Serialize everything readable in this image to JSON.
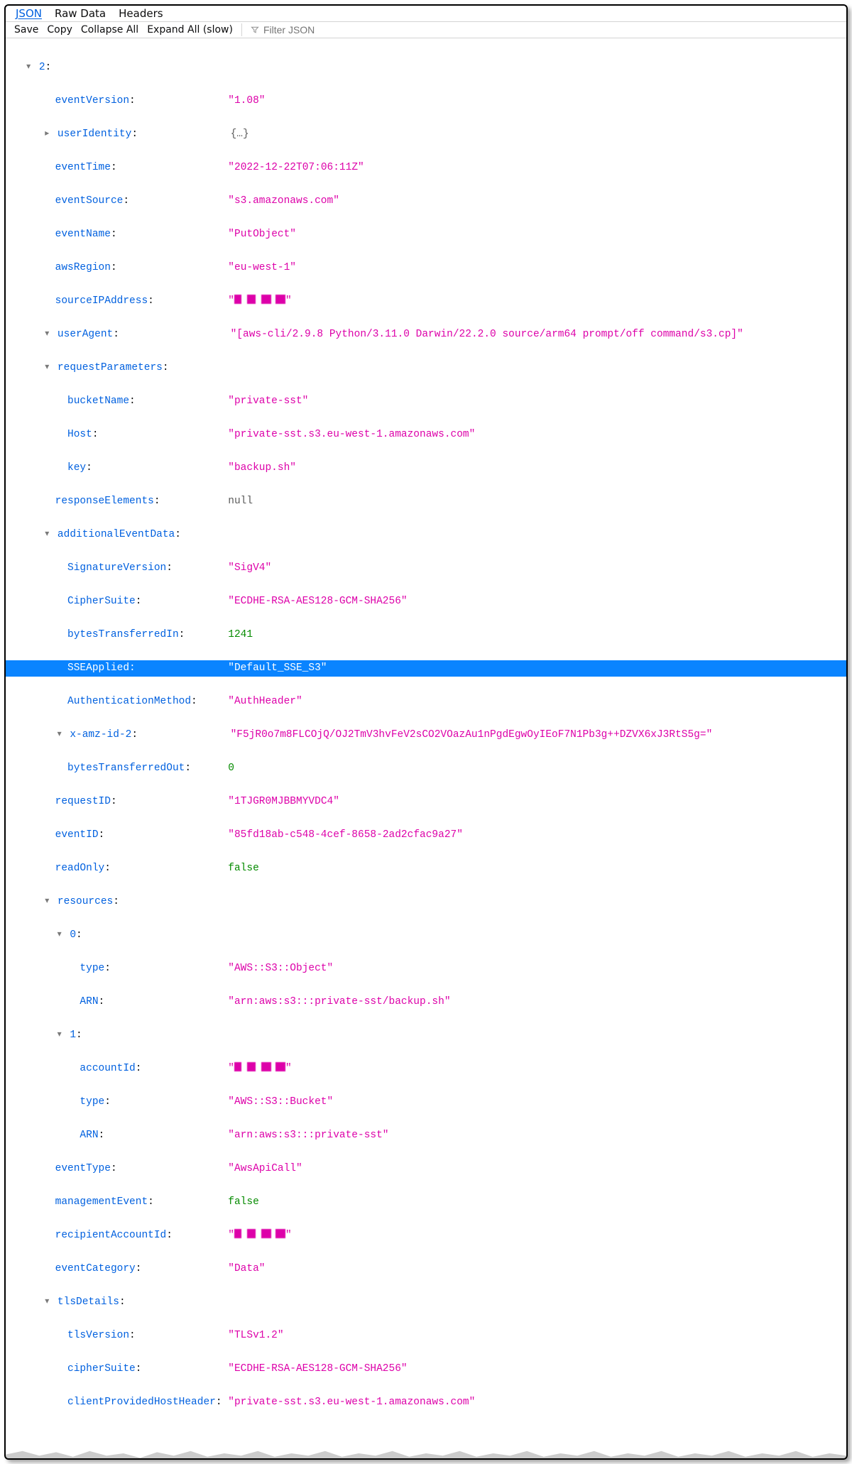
{
  "tabs": {
    "json": "JSON",
    "raw": "Raw Data",
    "headers": "Headers"
  },
  "toolbar": {
    "save": "Save",
    "copy": "Copy",
    "collapse": "Collapse All",
    "expand": "Expand All (slow)",
    "filter_placeholder": "Filter JSON"
  },
  "tree": {
    "index": "2",
    "eventVersion": "\"1.08\"",
    "userIdentity_key": "userIdentity",
    "userIdentity_val": "{…}",
    "eventTime": "\"2022-12-22T07:06:11Z\"",
    "eventSource": "\"s3.amazonaws.com\"",
    "eventName": "\"PutObject\"",
    "awsRegion": "\"eu-west-1\"",
    "sourceIPAddress_lquote": "\"",
    "sourceIPAddress_rquote": "\"",
    "userAgent": "\"[aws-cli/2.9.8 Python/3.11.0 Darwin/22.2.0 source/arm64 prompt/off command/s3.cp]\"",
    "requestParameters": {
      "bucketName": "\"private-sst\"",
      "Host": "\"private-sst.s3.eu-west-1.amazonaws.com\"",
      "key": "\"backup.sh\""
    },
    "responseElements": "null",
    "additionalEventData": {
      "SignatureVersion": "\"SigV4\"",
      "CipherSuite": "\"ECDHE-RSA-AES128-GCM-SHA256\"",
      "bytesTransferredIn": "1241",
      "SSEApplied": "\"Default_SSE_S3\"",
      "AuthenticationMethod": "\"AuthHeader\"",
      "x_amz_id_2": "\"F5jR0o7m8FLCOjQ/OJ2TmV3hvFeV2sCO2VOazAu1nPgdEgwOyIEoF7N1Pb3g++DZVX6xJ3RtS5g=\"",
      "bytesTransferredOut": "0"
    },
    "requestID": "\"1TJGR0MJBBMYVDC4\"",
    "eventID": "\"85fd18ab-c548-4cef-8658-2ad2cfac9a27\"",
    "readOnly": "false",
    "resources": {
      "0": {
        "type": "\"AWS::S3::Object\"",
        "ARN": "\"arn:aws:s3:::private-sst/backup.sh\""
      },
      "1": {
        "accountId_lquote": "\"",
        "accountId_rquote": "\"",
        "type": "\"AWS::S3::Bucket\"",
        "ARN": "\"arn:aws:s3:::private-sst\""
      }
    },
    "eventType": "\"AwsApiCall\"",
    "managementEvent": "false",
    "recipientAccountId_lquote": "\"",
    "recipientAccountId_rquote": "\"",
    "eventCategory": "\"Data\"",
    "tlsDetails": {
      "tlsVersion": "\"TLSv1.2\"",
      "cipherSuite": "\"ECDHE-RSA-AES128-GCM-SHA256\"",
      "clientProvidedHostHeader": "\"private-sst.s3.eu-west-1.amazonaws.com\""
    }
  },
  "labels": {
    "eventVersion": "eventVersion",
    "eventTime": "eventTime",
    "eventSource": "eventSource",
    "eventName": "eventName",
    "awsRegion": "awsRegion",
    "sourceIPAddress": "sourceIPAddress",
    "userAgent": "userAgent",
    "requestParameters": "requestParameters",
    "bucketName": "bucketName",
    "Host": "Host",
    "key": "key",
    "responseElements": "responseElements",
    "additionalEventData": "additionalEventData",
    "SignatureVersion": "SignatureVersion",
    "CipherSuite": "CipherSuite",
    "bytesTransferredIn": "bytesTransferredIn",
    "SSEApplied": "SSEApplied",
    "AuthenticationMethod": "AuthenticationMethod",
    "x_amz_id_2": "x-amz-id-2",
    "bytesTransferredOut": "bytesTransferredOut",
    "requestID": "requestID",
    "eventID": "eventID",
    "readOnly": "readOnly",
    "resources": "resources",
    "type": "type",
    "ARN": "ARN",
    "accountId": "accountId",
    "eventType": "eventType",
    "managementEvent": "managementEvent",
    "recipientAccountId": "recipientAccountId",
    "eventCategory": "eventCategory",
    "tlsDetails": "tlsDetails",
    "tlsVersion": "tlsVersion",
    "cipherSuite": "cipherSuite",
    "clientProvidedHostHeader": "clientProvidedHostHeader"
  }
}
